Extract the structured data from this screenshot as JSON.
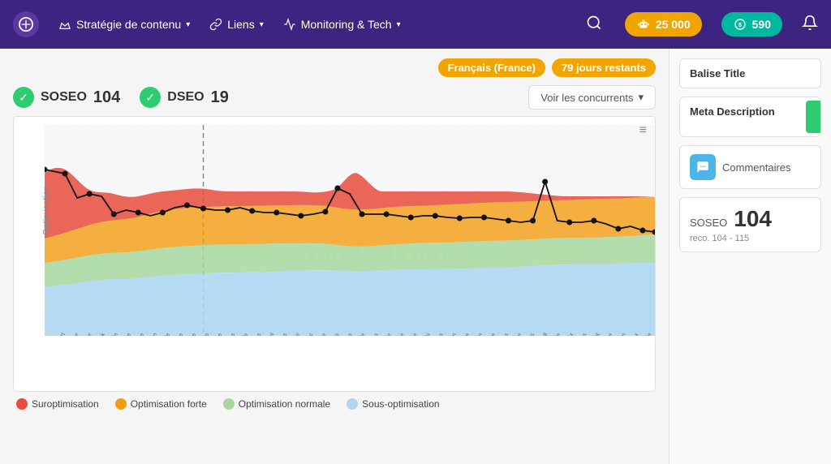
{
  "header": {
    "nav_items": [
      {
        "id": "strategie",
        "label": "Stratégie de contenu",
        "icon": "crown"
      },
      {
        "id": "liens",
        "label": "Liens",
        "icon": "link"
      },
      {
        "id": "monitoring",
        "label": "Monitoring & Tech",
        "icon": "pulse"
      }
    ],
    "credits_label": "25 000",
    "coins_label": "590"
  },
  "badges": {
    "lang": "Français (France)",
    "days": "79 jours restants"
  },
  "scores": {
    "soseo_label": "SOSEO",
    "soseo_value": "104",
    "dseo_label": "DSEO",
    "dseo_value": "19"
  },
  "btn_concurrents": "Voir les concurrents",
  "chart": {
    "menu_icon": "≡",
    "watermark": "Yourtext.Guru",
    "y_axis_label": "Optimisation"
  },
  "legend": [
    {
      "id": "suropt",
      "label": "Suroptimisation",
      "color": "#e74c3c"
    },
    {
      "id": "forte",
      "label": "Optimisation forte",
      "color": "#f39c12"
    },
    {
      "id": "normale",
      "label": "Optimisation normale",
      "color": "#a8d8a0"
    },
    {
      "id": "sous",
      "label": "Sous-optimisation",
      "color": "#aed6f1"
    }
  ],
  "right_panel": {
    "balise_title": "Balise Title",
    "meta_desc": "Meta Description",
    "commentaires_label": "Commentaires",
    "soseo_label": "SOSEO",
    "soseo_value": "104",
    "soseo_reco": "reco. 104 - 115"
  }
}
